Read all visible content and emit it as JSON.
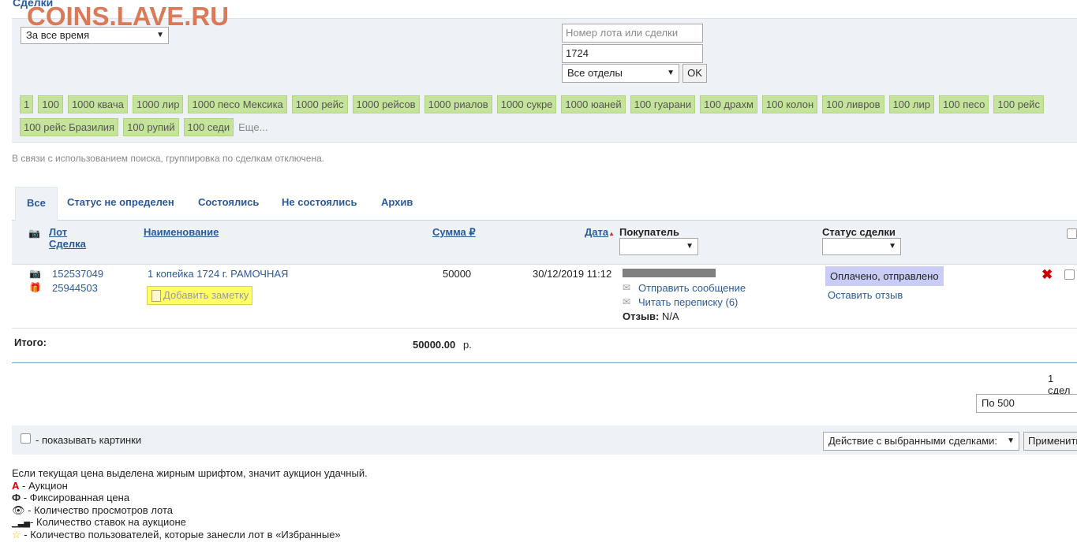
{
  "header": {
    "title": "Сделки",
    "watermark": "COINS.LAVE.RU"
  },
  "filters": {
    "period": "За все время",
    "lot_placeholder": "Номер лота или сделки",
    "lot_value": "1724",
    "department": "Все отделы",
    "ok_label": "OK",
    "tags": [
      "1",
      "100",
      "1000 квача",
      "1000 лир",
      "1000 песо Мексика",
      "1000 рейс",
      "1000 рейсов",
      "1000 риалов",
      "1000 сукре",
      "1000 юаней",
      "100 гуарани",
      "100 драхм",
      "100 колон",
      "100 ливров",
      "100 лир",
      "100 песо",
      "100 рейс",
      "100 рейс Бразилия",
      "100 рупий",
      "100 седи"
    ],
    "more_label": "Еще..."
  },
  "notice": "В связи с использованием поиска, группировка по сделкам отключена.",
  "tabs": [
    "Все",
    "Статус не определен",
    "Состоялись",
    "Не состоялись",
    "Архив"
  ],
  "table": {
    "headers": {
      "lot": "Лот",
      "deal": "Сделка",
      "name": "Наименование",
      "sum": "Сумма ₽",
      "date": "Дата",
      "buyer": "Покупатель",
      "status": "Статус сделки"
    },
    "row": {
      "lot": "152537049",
      "deal": "25944503",
      "name": "1 копейка 1724 г. РАМОЧНАЯ",
      "note_label": "Добавить заметку",
      "sum": "50000",
      "date": "30/12/2019 11:12",
      "send_message": "Отправить сообщение",
      "read_messages": "Читать переписку (6)",
      "review_label": "Отзыв:",
      "review_value": "N/A",
      "status": "Оплачено, отправлено",
      "leave_review": "Оставить отзыв"
    }
  },
  "total": {
    "label": "Итого:",
    "value": "50000.00",
    "currency": "р."
  },
  "pagination": {
    "count_text": "1 сдел",
    "per_page": "По 500"
  },
  "bottom": {
    "show_images": "- показывать картинки",
    "action": "Действие с выбранными сделками:",
    "apply": "Применить"
  },
  "legend": {
    "line1": "Если текущая цена выделена жирным шрифтом, значит аукцион удачный.",
    "a_mark": "А",
    "a_text": "- Аукцион",
    "f_mark": "Ф",
    "f_text": "- Фиксированная цена",
    "views": "- Количество просмотров лота",
    "bids": "- Количество ставок на аукционе",
    "favs": "- Количество пользователей, которые занесли лот в «Избранные»"
  },
  "colors": {
    "link": "#2a5a9c",
    "tag_bg": "#c5e39a",
    "panel_bg": "#eef2f7",
    "status_bg": "#c9cdf5",
    "note_bg": "#ffff66",
    "watermark": "#d9734e"
  }
}
